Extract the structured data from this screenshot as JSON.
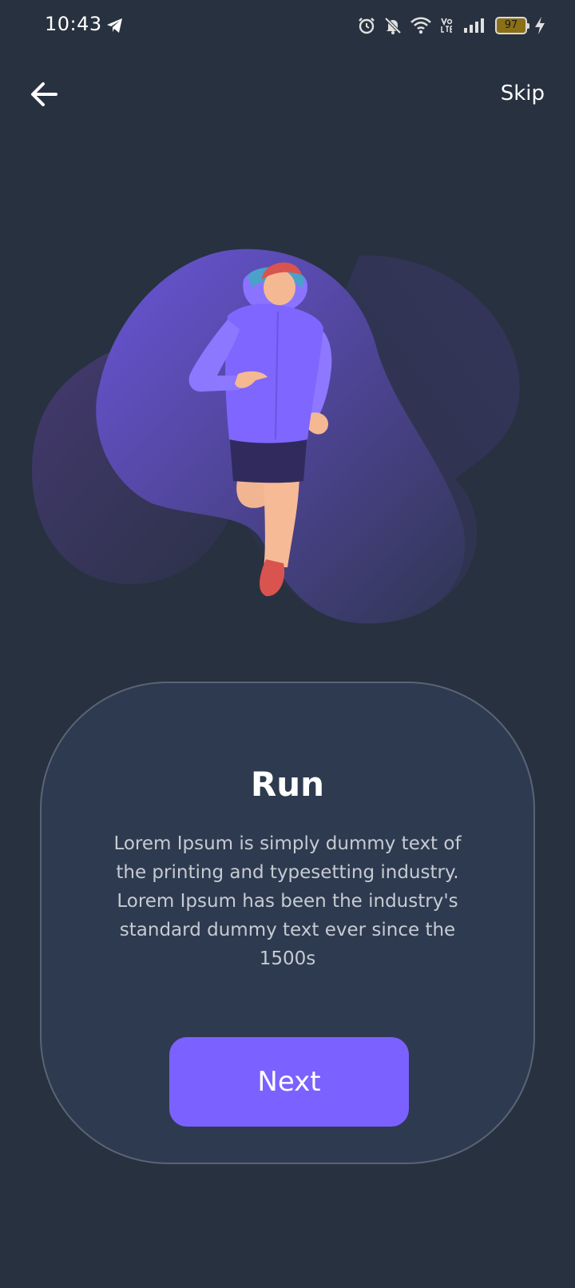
{
  "status_bar": {
    "time": "10:43",
    "battery_level": "97",
    "icons": [
      "telegram-icon",
      "alarm-icon",
      "mute-bell-icon",
      "wifi-icon",
      "volte-icon",
      "signal-icon",
      "battery-icon",
      "charging-icon"
    ]
  },
  "nav": {
    "back_icon": "arrow-left-icon",
    "skip_label": "Skip"
  },
  "illustration": {
    "subject": "runner"
  },
  "card": {
    "title": "Run",
    "description": "Lorem Ipsum is simply dummy text of the printing and typesetting industry. Lorem Ipsum has been the industry's standard dummy text ever since the 1500s",
    "button_label": "Next"
  },
  "colors": {
    "background": "#28313f",
    "card": "#2e3a4f",
    "accent": "#7b61ff"
  }
}
